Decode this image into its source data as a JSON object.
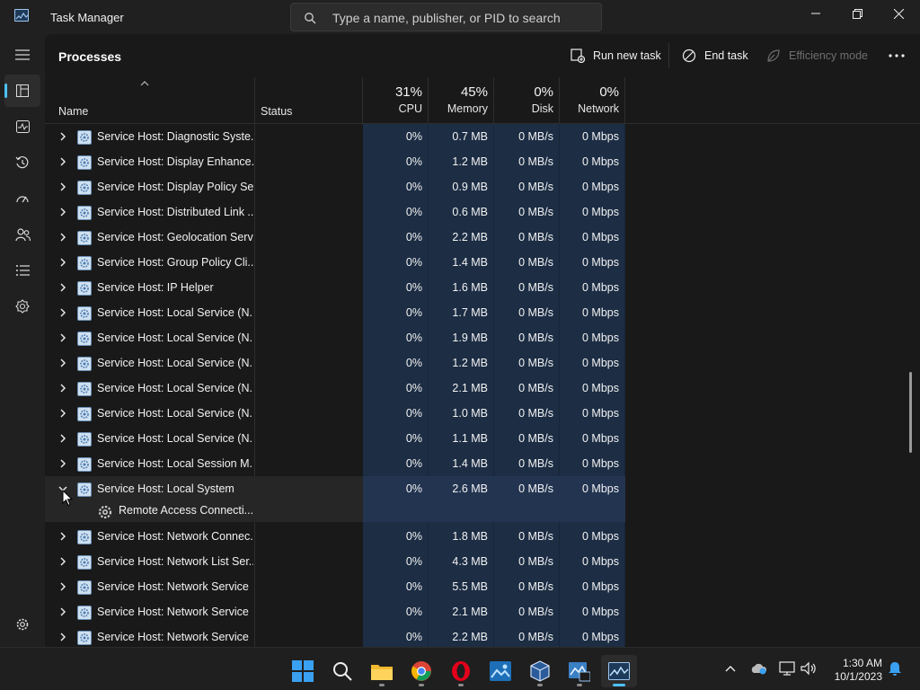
{
  "window": {
    "title": "Task Manager"
  },
  "search": {
    "placeholder": "Type a name, publisher, or PID to search"
  },
  "toolbar": {
    "page_title": "Processes",
    "run_new_task": "Run new task",
    "end_task": "End task",
    "efficiency_mode": "Efficiency mode"
  },
  "columns": {
    "name": "Name",
    "status": "Status",
    "cpu": {
      "pct": "31%",
      "label": "CPU"
    },
    "memory": {
      "pct": "45%",
      "label": "Memory"
    },
    "disk": {
      "pct": "0%",
      "label": "Disk"
    },
    "network": {
      "pct": "0%",
      "label": "Network"
    }
  },
  "rows": [
    {
      "name": "Service Host: Diagnostic Syste...",
      "cpu": "0%",
      "memory": "0.7 MB",
      "disk": "0 MB/s",
      "network": "0 Mbps"
    },
    {
      "name": "Service Host: Display Enhance...",
      "cpu": "0%",
      "memory": "1.2 MB",
      "disk": "0 MB/s",
      "network": "0 Mbps"
    },
    {
      "name": "Service Host: Display Policy Se...",
      "cpu": "0%",
      "memory": "0.9 MB",
      "disk": "0 MB/s",
      "network": "0 Mbps"
    },
    {
      "name": "Service Host: Distributed Link ...",
      "cpu": "0%",
      "memory": "0.6 MB",
      "disk": "0 MB/s",
      "network": "0 Mbps"
    },
    {
      "name": "Service Host: Geolocation Serv...",
      "cpu": "0%",
      "memory": "2.2 MB",
      "disk": "0 MB/s",
      "network": "0 Mbps"
    },
    {
      "name": "Service Host: Group Policy Cli...",
      "cpu": "0%",
      "memory": "1.4 MB",
      "disk": "0 MB/s",
      "network": "0 Mbps"
    },
    {
      "name": "Service Host: IP Helper",
      "cpu": "0%",
      "memory": "1.6 MB",
      "disk": "0 MB/s",
      "network": "0 Mbps"
    },
    {
      "name": "Service Host: Local Service (N...",
      "cpu": "0%",
      "memory": "1.7 MB",
      "disk": "0 MB/s",
      "network": "0 Mbps"
    },
    {
      "name": "Service Host: Local Service (N...",
      "cpu": "0%",
      "memory": "1.9 MB",
      "disk": "0 MB/s",
      "network": "0 Mbps"
    },
    {
      "name": "Service Host: Local Service (N...",
      "cpu": "0%",
      "memory": "1.2 MB",
      "disk": "0 MB/s",
      "network": "0 Mbps"
    },
    {
      "name": "Service Host: Local Service (N...",
      "cpu": "0%",
      "memory": "2.1 MB",
      "disk": "0 MB/s",
      "network": "0 Mbps"
    },
    {
      "name": "Service Host: Local Service (N...",
      "cpu": "0%",
      "memory": "1.0 MB",
      "disk": "0 MB/s",
      "network": "0 Mbps"
    },
    {
      "name": "Service Host: Local Service (N...",
      "cpu": "0%",
      "memory": "1.1 MB",
      "disk": "0 MB/s",
      "network": "0 Mbps"
    },
    {
      "name": "Service Host: Local Session M...",
      "cpu": "0%",
      "memory": "1.4 MB",
      "disk": "0 MB/s",
      "network": "0 Mbps"
    },
    {
      "name": "Service Host: Local System",
      "cpu": "0%",
      "memory": "2.6 MB",
      "disk": "0 MB/s",
      "network": "0 Mbps",
      "expanded": true
    },
    {
      "name": "Remote Access Connecti...",
      "child": true
    },
    {
      "name": "Service Host: Network Connec...",
      "cpu": "0%",
      "memory": "1.8 MB",
      "disk": "0 MB/s",
      "network": "0 Mbps"
    },
    {
      "name": "Service Host: Network List Ser...",
      "cpu": "0%",
      "memory": "4.3 MB",
      "disk": "0 MB/s",
      "network": "0 Mbps"
    },
    {
      "name": "Service Host: Network Service",
      "cpu": "0%",
      "memory": "5.5 MB",
      "disk": "0 MB/s",
      "network": "0 Mbps"
    },
    {
      "name": "Service Host: Network Service",
      "cpu": "0%",
      "memory": "2.1 MB",
      "disk": "0 MB/s",
      "network": "0 Mbps"
    },
    {
      "name": "Service Host: Network Service",
      "cpu": "0%",
      "memory": "2.2 MB",
      "disk": "0 MB/s",
      "network": "0 Mbps"
    }
  ],
  "nav": [
    "hamburger-icon",
    "processes-icon",
    "performance-icon",
    "app-history-icon",
    "startup-apps-icon",
    "users-icon",
    "details-icon",
    "services-icon",
    "settings-icon"
  ],
  "taskbar": {
    "apps": [
      "start-icon",
      "search-icon",
      "file-explorer-icon",
      "chrome-icon",
      "opera-icon",
      "photo-app-icon",
      "virtualbox-icon",
      "win10-app-icon",
      "task-manager-icon"
    ],
    "clock_time": "1:30 AM",
    "clock_date": "10/1/2023"
  },
  "colors": {
    "accent": "#4cc2ff",
    "metric_column_bg": "#1c2d44",
    "window_bg": "#202020"
  }
}
